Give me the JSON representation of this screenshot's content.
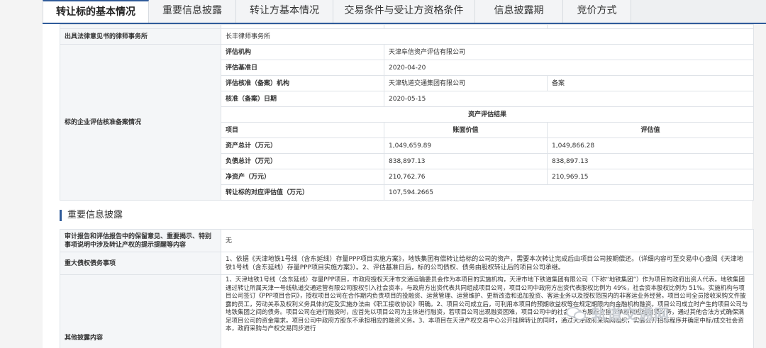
{
  "tabs": [
    {
      "label": "转让标的基本情况",
      "active": true
    },
    {
      "label": "重要信息披露",
      "active": false
    },
    {
      "label": "转让方基本情况",
      "active": false
    },
    {
      "label": "交易条件与受让方资格条件",
      "active": false
    },
    {
      "label": "信息披露期",
      "active": false
    },
    {
      "label": "竞价方式",
      "active": false
    }
  ],
  "basic": {
    "lawyer_label": "出具法律意见书的律师事务所",
    "lawyer_value": "长丰律师事务所",
    "filing_label": "标的企业评估核准备案情况",
    "org_label": "评估机构",
    "org_value": "天津阜信资产评估有限公司",
    "base_date_label": "评估基准日",
    "base_date_value": "2020-04-20",
    "approval_org_label": "评估核准（备案）机构",
    "approval_org_value": "天津轨道交通集团有限公司",
    "approval_type": "备案",
    "approval_date_label": "核准（备案）日期",
    "approval_date_value": "2020-05-15",
    "result_header": "资产评估结果",
    "col_item": "项目",
    "col_book": "账面价值",
    "col_eval": "评估值",
    "rows": [
      {
        "item": "资产总计（万元）",
        "book": "1,049,659.89",
        "eval": "1,049,866.28"
      },
      {
        "item": "负债总计（万元）",
        "book": "838,897.13",
        "eval": "838,897.13"
      },
      {
        "item": "净资产（万元）",
        "book": "210,762.76",
        "eval": "210,969.15"
      }
    ],
    "target_label": "转让标的对应评估值（万元）",
    "target_value": "107,594.2665"
  },
  "disclosure": {
    "section_title": "重要信息披露",
    "audit_label": "审计报告和评估报告中的保留意见、重要揭示、特别事项说明中涉及转让产权的提示提醒等内容",
    "audit_value": "无",
    "debt_label": "重大债权债务事项",
    "debt_value": "1、依据《天津地铁1号线（含东延线）存量PPP项目实施方案》，地铁集团有偿转让给标的公司的资产，需要本次转让完成后由项目公司按期偿还。（详细内容可至交易中心查阅《天津地铁1号线（含东延线）存量PPP项目实施方案》）。2、评估基准日后，标的公司债权、债务由股权转让后的项目公司承继。",
    "other_label": "其他披露内容",
    "other_value": "1、天津地铁1号线（含东延线）存量PPP项目，市政府授权天津市交通运输委员会作为本项目的实施机构，天津市地下铁道集团有限公司（下称“地铁集团”）作为项目的政府出资人代表。地铁集团通过转让所属天津一号线轨道交通运营有限公司股权引入社会资本，与政府方出资代表共同组成项目公司，项目公司中政府方出资代表股权比例为 49%，社会资本股权比例为 51%。实施机构与项目公司签订《PPP项目合同》，授权项目公司在合作期内负责项目的投融资、运营管理、运营维护、更新改造和追加投资、客运业务以及授权范围内的非客运业务经营。项目公司全员接收采购文件披露的员工，劳动关系及权利义务具体约定及实施办法由《职工接收协议》明确。2、项目公司成立后，可利用本项目的预期收益权等在规定期限内向金融机构融资。项目公司成立时产生的项目公司与地铁集团之间的债务。项目公司在进行融资时，应首先以项目公司为主体进行融资，若项目公司出现融资困难，项目公司中的社会资本方股东应独立承担相应的融资义务，通过其他合法方式确保满足项目公司的资金需求。项目公司中政府方股东不承担相应的融资义务。3、本项目在天津产权交易中心公开挂牌转让的同时，通过天津政府采购网组织，实施公开招标程序并确定中标/成交社会资本，政府采购与产权交易同步进行"
  },
  "watermark": {
    "text": "轨道交通网"
  }
}
